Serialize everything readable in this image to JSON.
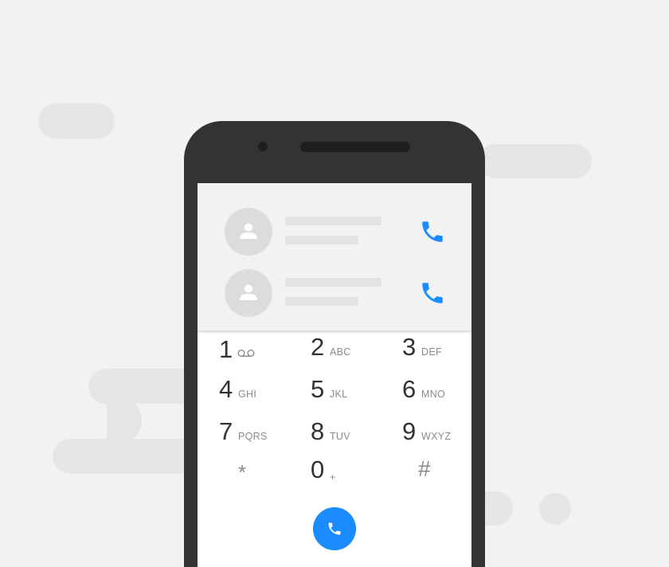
{
  "colors": {
    "background": "#f2f2f2",
    "cloud": "#e6e6e6",
    "phone_body": "#333333",
    "screen": "#ffffff",
    "contacts_panel": "#f2f2f2",
    "accent": "#1a8cff",
    "digit_text": "#333333",
    "letters_text": "#8a8a8a"
  },
  "icons": {
    "avatar": "person-icon",
    "call": "phone-handset-icon",
    "voicemail": "voicemail-icon",
    "dial": "phone-handset-icon"
  },
  "contacts": [
    {
      "icon": "person-icon",
      "call_icon": "phone-handset-icon"
    },
    {
      "icon": "person-icon",
      "call_icon": "phone-handset-icon"
    }
  ],
  "keypad": {
    "keys": [
      {
        "digit": "1",
        "letters": "",
        "icon": "voicemail-icon"
      },
      {
        "digit": "2",
        "letters": "ABC"
      },
      {
        "digit": "3",
        "letters": "DEF"
      },
      {
        "digit": "4",
        "letters": "GHI"
      },
      {
        "digit": "5",
        "letters": "JKL"
      },
      {
        "digit": "6",
        "letters": "MNO"
      },
      {
        "digit": "7",
        "letters": "PQRS"
      },
      {
        "digit": "8",
        "letters": "TUV"
      },
      {
        "digit": "9",
        "letters": "WXYZ"
      },
      {
        "digit": "*",
        "letters": ""
      },
      {
        "digit": "0",
        "letters": "+"
      },
      {
        "digit": "#",
        "letters": ""
      }
    ]
  }
}
